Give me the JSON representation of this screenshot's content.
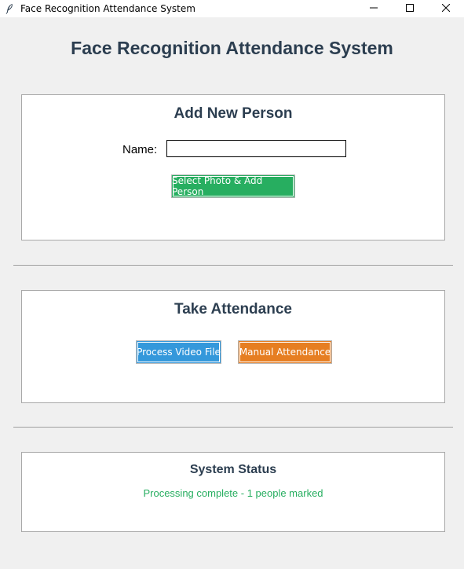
{
  "window": {
    "title": "Face Recognition Attendance System",
    "icon": "feather-icon",
    "controls": [
      "minimize-icon",
      "maximize-icon",
      "close-icon"
    ]
  },
  "header": {
    "title": "Face Recognition Attendance System"
  },
  "add_person": {
    "title": "Add New Person",
    "name_label": "Name:",
    "name_value": "",
    "select_button_label": "Select Photo & Add Person"
  },
  "attendance": {
    "title": "Take Attendance",
    "process_video_label": "Process Video File",
    "manual_attendance_label": "Manual Attendance"
  },
  "status": {
    "title": "System Status",
    "message": "Processing complete - 1 people marked"
  },
  "colors": {
    "heading": "#2c3e50",
    "green": "#27ae60",
    "blue": "#3498db",
    "orange": "#e67e22",
    "background": "#f0f0f0"
  }
}
